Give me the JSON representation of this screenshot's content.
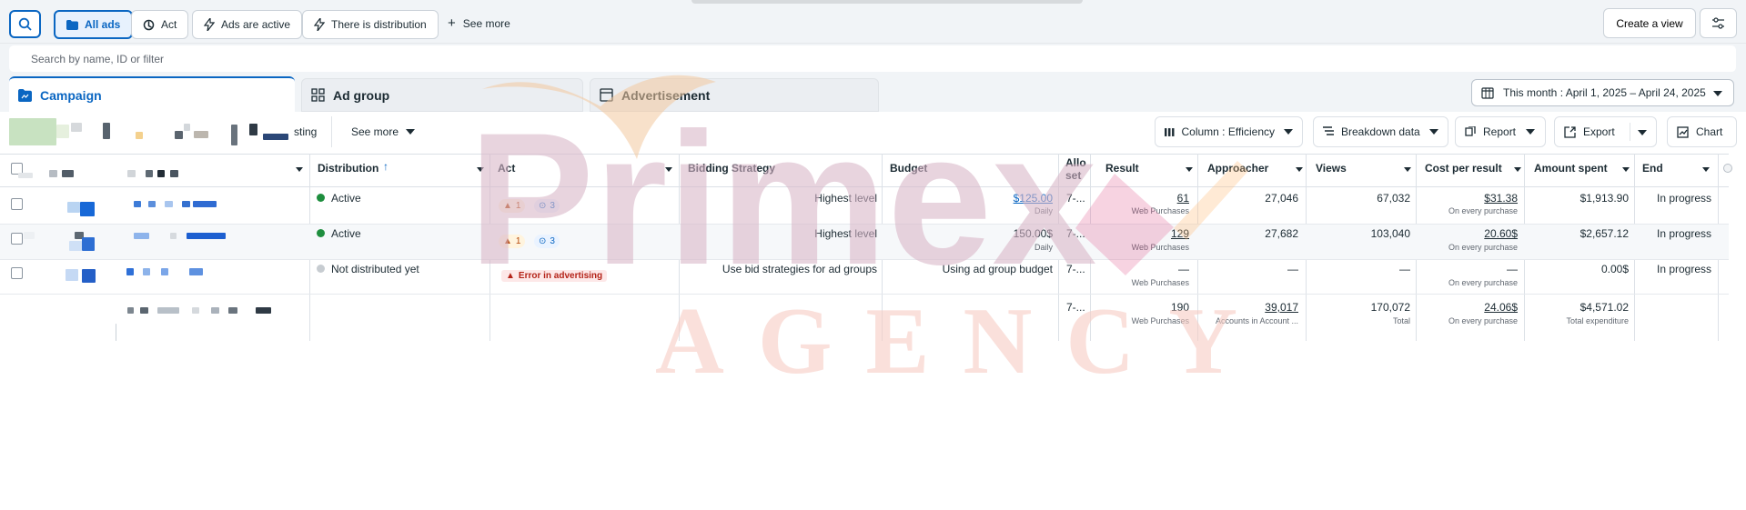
{
  "topbar": {
    "filters": [
      "All ads",
      "Act",
      "Ads are active",
      "There is distribution"
    ],
    "see_more": "See more",
    "create_view": "Create a view"
  },
  "search": {
    "placeholder": "Search by name, ID or filter"
  },
  "tabs": {
    "campaign": "Campaign",
    "ad_group": "Ad group",
    "advertisement": "Advertisement"
  },
  "date_range": "This month : April 1, 2025 – April 24, 2025",
  "toolbar": {
    "partial_label": "sting",
    "see_more": "See more",
    "column": "Column : Efficiency",
    "breakdown": "Breakdown data",
    "report": "Report",
    "export": "Export",
    "chart": "Chart"
  },
  "table": {
    "headers": {
      "distribution": "Distribution",
      "act": "Act",
      "bidding": "Bidding Strategy",
      "budget": "Budget",
      "allocation": "Allo set",
      "result": "Result",
      "approacher": "Approacher",
      "views": "Views",
      "cost_per_result": "Cost per result",
      "amount_spent": "Amount spent",
      "end": "End"
    },
    "rows": [
      {
        "distribution": "Active",
        "act_warning_count": "1",
        "act_sync_count": "3",
        "bidding": "Highest level",
        "budget": "$125.00",
        "budget_period": "Daily",
        "allocation": "7-...",
        "result": "61",
        "result_type": "Web Purchases",
        "approacher": "27,046",
        "views": "67,032",
        "cost_per_result": "$31.38",
        "cost_note": "On every purchase",
        "amount_spent": "$1,913.90",
        "end": "In progress"
      },
      {
        "distribution": "Active",
        "act_warning_count": "1",
        "act_sync_count": "3",
        "bidding": "Highest level",
        "budget": "150.00$",
        "budget_period": "Daily",
        "allocation": "7-...",
        "result": "129",
        "result_type": "Web Purchases",
        "approacher": "27,682",
        "views": "103,040",
        "cost_per_result": "20.60$",
        "cost_note": "On every purchase",
        "amount_spent": "$2,657.12",
        "end": "In progress"
      },
      {
        "distribution": "Not distributed yet",
        "act_error": "Error in advertising",
        "bidding": "Use bid strategies for ad groups",
        "budget": "Using ad group budget",
        "allocation": "7-...",
        "result": "—",
        "result_type": "Web Purchases",
        "approacher": "—",
        "views": "—",
        "cost_per_result": "—",
        "cost_note": "On every purchase",
        "amount_spent": "0.00$",
        "end": "In progress"
      }
    ],
    "totals": {
      "allocation": "7-...",
      "result": "190",
      "result_type": "Web Purchases",
      "approacher": "39,017",
      "approacher_note": "Accounts in Account ...",
      "views": "170,072",
      "views_note": "Total",
      "cost_per_result": "24.06$",
      "cost_note": "On every purchase",
      "amount_spent": "$4,571.02",
      "amount_note": "Total expenditure"
    }
  },
  "watermark": {
    "top": "Primex",
    "bottom": "AGENCY"
  },
  "colors": {
    "primary": "#0a66c2",
    "active_status": "#1e8e3e",
    "warning": "#f59e0b",
    "error": "#b42318",
    "border": "#dce1e7"
  },
  "icons": [
    "search-icon",
    "folder-icon",
    "sync-icon",
    "lightning-icon",
    "plus-icon",
    "settings-icon",
    "grid-icon",
    "document-icon",
    "calendar-icon",
    "columns-icon",
    "breakdown-icon",
    "report-icon",
    "export-icon",
    "chart-icon",
    "warning-icon",
    "caret-down-icon",
    "sort-up-icon"
  ]
}
